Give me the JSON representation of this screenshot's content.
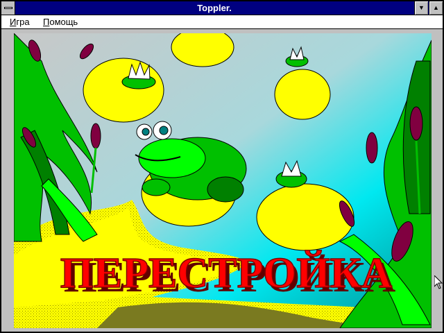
{
  "window": {
    "title": "Toppler.",
    "minimize_glyph": "▼",
    "maximize_glyph": "▲"
  },
  "menu": {
    "items": [
      {
        "label": "Игра"
      },
      {
        "label": "Помощь"
      }
    ]
  },
  "scene": {
    "caption": "ПЕРЕСТРОЙКА",
    "colors": {
      "water_light": "#00ffff",
      "water_dark": "#008080",
      "lily_pad": "#ffff00",
      "reed_green": "#00c000",
      "cattail": "#800040",
      "frog": "#00c000",
      "caption_fill": "#ff0000"
    }
  }
}
